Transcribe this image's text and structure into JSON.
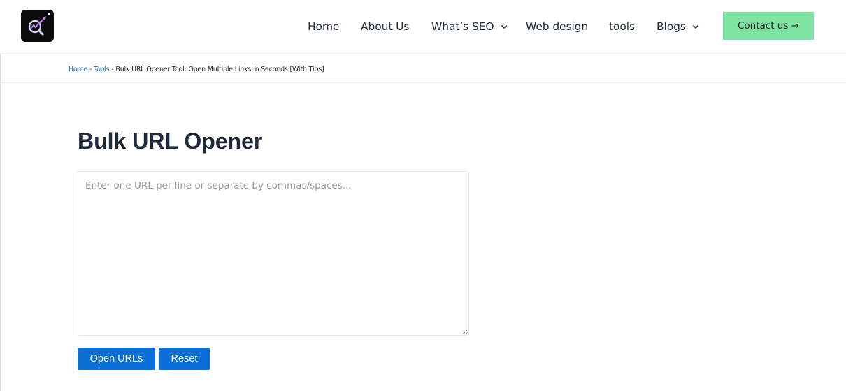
{
  "header": {
    "logo": "seo-analytics-logo",
    "nav": [
      {
        "label": "Home",
        "has_dropdown": false
      },
      {
        "label": "About Us",
        "has_dropdown": false
      },
      {
        "label": "What’s SEO",
        "has_dropdown": true
      },
      {
        "label": "Web design",
        "has_dropdown": false
      },
      {
        "label": "tools",
        "has_dropdown": false
      },
      {
        "label": "Blogs",
        "has_dropdown": true
      }
    ],
    "contact_label": "Contact us →"
  },
  "breadcrumb": {
    "home": "Home",
    "sep1": " - ",
    "tools": "Tools",
    "sep2": " - ",
    "current": "Bulk URL Opener Tool: Open Multiple Links In Seconds [With Tips]"
  },
  "main": {
    "title": "Bulk URL Opener",
    "textarea_value": "",
    "textarea_placeholder": "Enter one URL per line or separate by commas/spaces...",
    "open_label": "Open URLs",
    "reset_label": "Reset"
  },
  "colors": {
    "contact_bg": "#7fe3a3",
    "button_bg": "#0a6fd6",
    "link": "#1a5fb4",
    "title": "#1e2a3a"
  }
}
